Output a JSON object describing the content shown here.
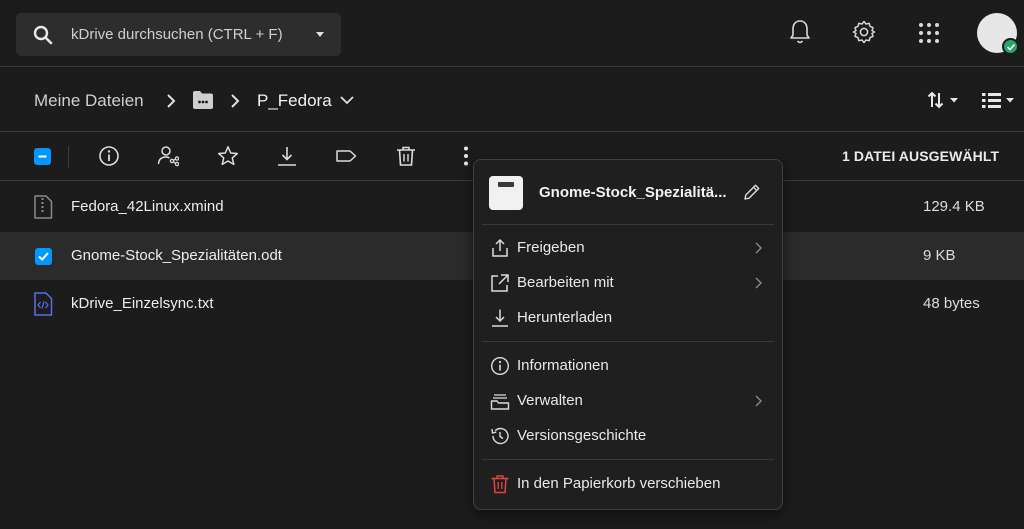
{
  "search": {
    "placeholder": "kDrive durchsuchen (CTRL + F)"
  },
  "header": {
    "icons": [
      "bell-icon",
      "gear-icon",
      "apps-grid-icon",
      "avatar"
    ],
    "status_color": "#2aa46a"
  },
  "breadcrumb": {
    "home": "Meine Dateien",
    "folder_icon": "folder-dots-icon",
    "current": "P_Fedora"
  },
  "toolbar": {
    "actions": [
      "info-icon",
      "share-user-icon",
      "star-icon",
      "download-icon",
      "tag-icon",
      "trash-icon",
      "more-icon"
    ],
    "selection_count": "1 DATEI AUSGEWÄHLT"
  },
  "files": [
    {
      "name": "Fedora_42Linux.xmind",
      "size": "129.4 KB",
      "icon": "zip-file-icon",
      "selected": false
    },
    {
      "name": "Gnome-Stock_Spezialitäten.odt",
      "size": "9 KB",
      "icon": "checkbox-icon",
      "selected": true
    },
    {
      "name": "kDrive_Einzelsync.txt",
      "size": "48 bytes",
      "icon": "code-file-icon",
      "selected": false
    }
  ],
  "context_menu": {
    "title": "Gnome-Stock_Spezialitä...",
    "items": [
      {
        "label": "Freigeben",
        "icon": "share-icon",
        "submenu": true
      },
      {
        "label": "Bearbeiten mit",
        "icon": "external-link-icon",
        "submenu": true
      },
      {
        "label": "Herunterladen",
        "icon": "download-icon",
        "submenu": false
      },
      {
        "label": "Informationen",
        "icon": "info-icon",
        "submenu": false
      },
      {
        "label": "Verwalten",
        "icon": "manage-folder-icon",
        "submenu": true
      },
      {
        "label": "Versionsgeschichte",
        "icon": "history-icon",
        "submenu": false
      },
      {
        "label": "In den Papierkorb verschieben",
        "icon": "trash-icon",
        "submenu": false,
        "danger": true
      }
    ]
  },
  "colors": {
    "background": "#1c1c1c",
    "accent": "#0098ff",
    "danger": "#e2453c",
    "selected_row": "#2b2b2b"
  }
}
